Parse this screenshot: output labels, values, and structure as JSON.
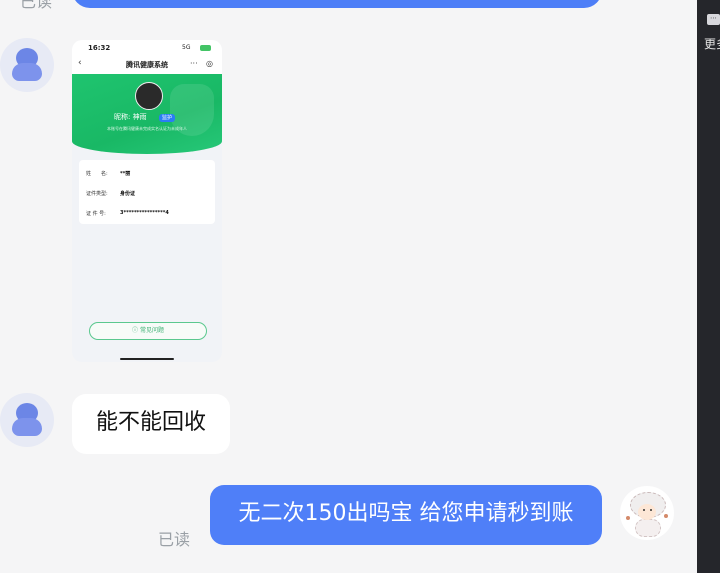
{
  "chat": {
    "read_status_top": "已读",
    "read_status_bottom": "已读",
    "message_question": "能不能回收",
    "message_reply": "无二次150出吗宝 给您申请秒到账"
  },
  "screenshot": {
    "time": "16:32",
    "signal": "5G",
    "title": "腾讯健康系统",
    "nickname": "昵称: 神雨",
    "tag": "监护",
    "description": "本账号在腾讯健康未完成实名认证为未成年人",
    "rows": [
      {
        "label": "姓　　名:",
        "value": "**丽"
      },
      {
        "label": "证件类型:",
        "value": "身份证"
      },
      {
        "label": "证 件 号:",
        "value": "3****************4"
      }
    ],
    "faq_label": "常见问题"
  },
  "side_panel": {
    "more_icon_text": "⋯",
    "more_label": "更多"
  },
  "colors": {
    "bubble_blue": "#4f7ff8",
    "health_green": "#1fc46f",
    "background": "#f5f5f6"
  }
}
